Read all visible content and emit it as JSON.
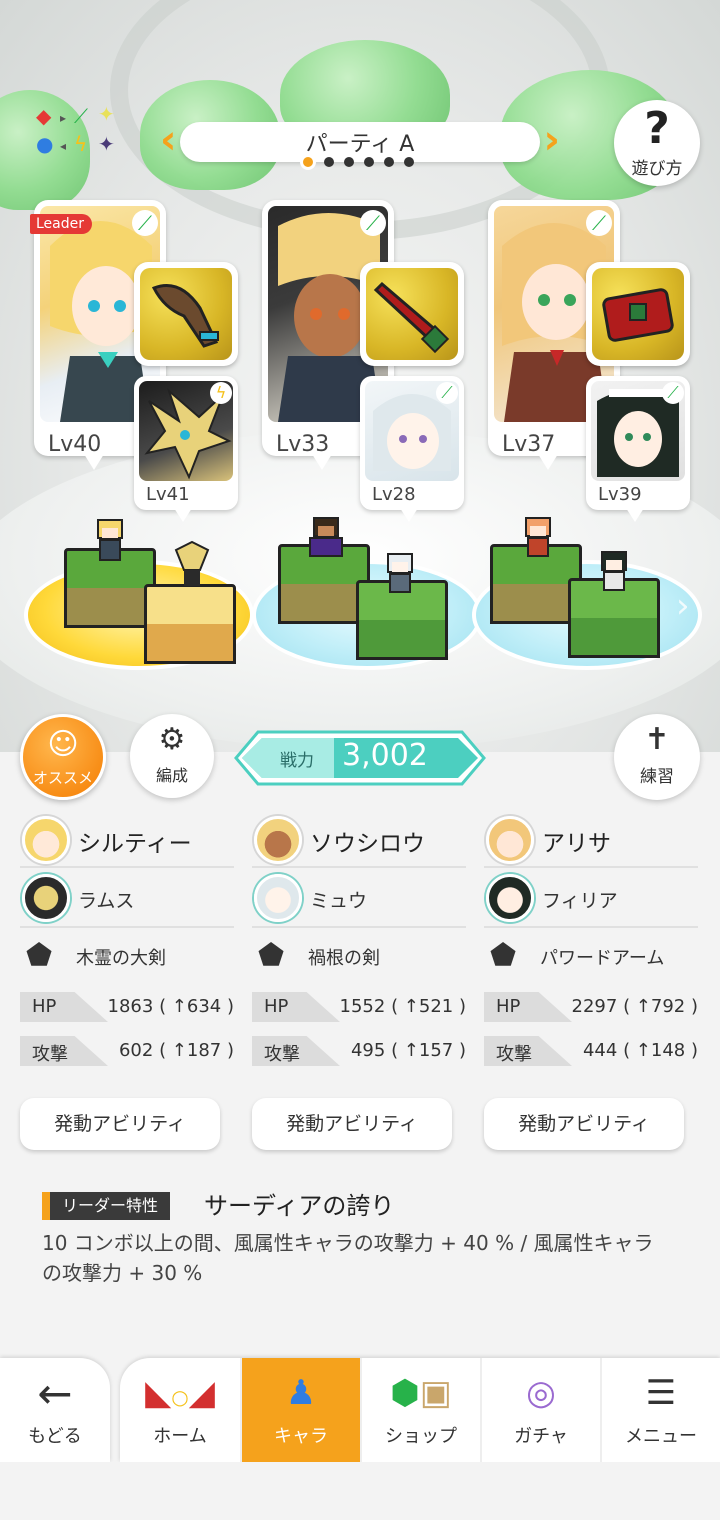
{
  "party": {
    "title": "パーティ A",
    "page_count": 6,
    "active_page": 1
  },
  "howto": {
    "label": "遊び方",
    "icon": "question-icon"
  },
  "element_legend": {
    "icon": "element-cycle-icon"
  },
  "leader_tag": "Leader",
  "characters": [
    {
      "name": "シルティー",
      "level": "Lv40",
      "attribute": "wind",
      "weapon": "木霊の大剣",
      "sub": {
        "name": "ラムス",
        "level": "Lv41",
        "attribute": "thunder"
      },
      "hp": "1863",
      "hp_bonus": "( ↑634 )",
      "atk": "602",
      "atk_bonus": "( ↑187 )"
    },
    {
      "name": "ソウシロウ",
      "level": "Lv33",
      "attribute": "wind",
      "weapon": "禍根の剣",
      "sub": {
        "name": "ミュウ",
        "level": "Lv28",
        "attribute": "wind"
      },
      "hp": "1552",
      "hp_bonus": "( ↑521 )",
      "atk": "495",
      "atk_bonus": "( ↑157 )"
    },
    {
      "name": "アリサ",
      "level": "Lv37",
      "attribute": "wind",
      "weapon": "パワードアーム",
      "sub": {
        "name": "フィリア",
        "level": "Lv39",
        "attribute": "wind"
      },
      "hp": "2297",
      "hp_bonus": "( ↑792 )",
      "atk": "444",
      "atk_bonus": "( ↑148 )"
    }
  ],
  "stat_labels": {
    "hp": "HP",
    "atk": "攻撃"
  },
  "ability_button": "発動アビリティ",
  "buttons": {
    "recommend": "オススメ",
    "formation": "編成",
    "practice": "練習"
  },
  "power": {
    "label": "戦力",
    "value": "3,002"
  },
  "leader_skill": {
    "badge": "リーダー特性",
    "title": "サーディアの誇り",
    "description": "10 コンボ以上の間、風属性キャラの攻撃力 + 40 % / 風属性キャラの攻撃力 + 30 %"
  },
  "nav": {
    "back": "もどる",
    "tabs": [
      {
        "label": "ホーム",
        "icon": "home-icon",
        "active": false
      },
      {
        "label": "キャラ",
        "icon": "character-icon",
        "active": true
      },
      {
        "label": "ショップ",
        "icon": "shop-icon",
        "active": false
      },
      {
        "label": "ガチャ",
        "icon": "gacha-icon",
        "active": false
      },
      {
        "label": "メニュー",
        "icon": "menu-icon",
        "active": false
      }
    ]
  },
  "colors": {
    "accent": "#f5a21c",
    "power": "#4ccfc0",
    "wind": "#27b24a",
    "leader": "#e53935"
  }
}
